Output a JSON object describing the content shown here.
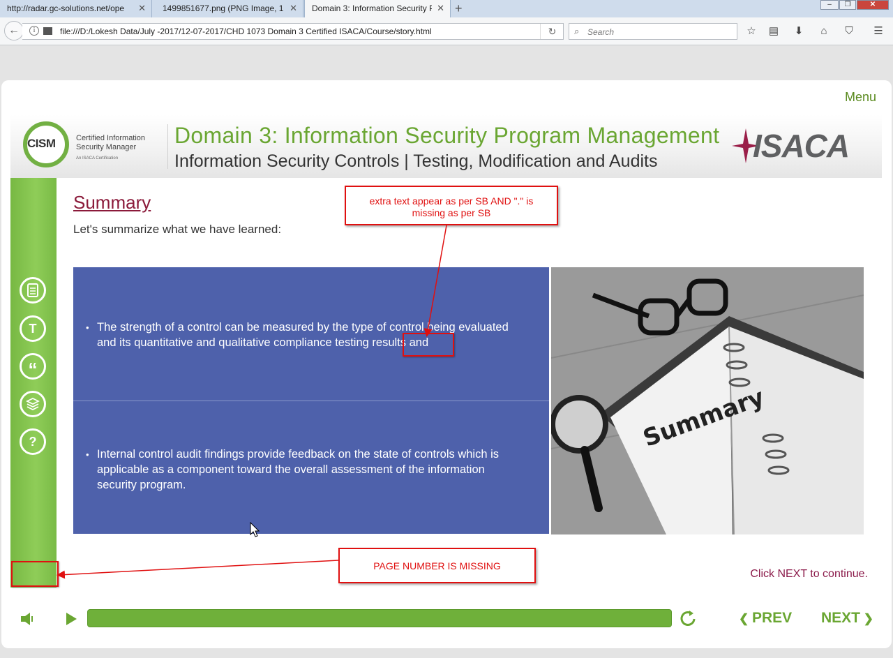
{
  "browser": {
    "tabs": [
      {
        "title": "http://radar.gc-solutions.net/ope",
        "active": false
      },
      {
        "title": "1499851677.png (PNG Image, 127",
        "active": false
      },
      {
        "title": "Domain 3: Information Security P",
        "active": true
      }
    ],
    "url": "file:///D:/Lokesh Data/July -2017/12-07-2017/CHD 1073 Domain 3 Certified ISACA/Course/story.html",
    "search_placeholder": "Search"
  },
  "course": {
    "menu_label": "Menu",
    "cism_logo": {
      "word": "CISM",
      "line1": "Certified Information",
      "line2": "Security Manager",
      "line3": "An ISACA Certification"
    },
    "banner_title": "Domain 3: Information Security Program Management",
    "banner_subtitle": "Information Security Controls | Testing, Modification and Audits",
    "isaca_logo": "ISACA",
    "sidebar_icons": [
      "notes-icon",
      "glossary-icon",
      "quote-icon",
      "layers-icon",
      "help-icon"
    ],
    "sidebar_glyphs": {
      "glossary": "T",
      "quote": "“",
      "help": "?"
    },
    "summary_title": "Summary",
    "summary_intro": "Let's summarize what we have learned:",
    "points": [
      "The strength of a control can be measured by the type of control being evaluated and its quantitative and qualitative compliance testing results and",
      "Internal control audit findings provide feedback on the state of controls which is applicable as a component toward the overall assessment of the information security program."
    ],
    "photo_caption": "Summary",
    "continue_hint": "Click NEXT to continue.",
    "prev_label": "PREV",
    "next_label": "NEXT",
    "progress_fraction": 1.0,
    "bullet": "•"
  },
  "annotations": {
    "extra_text": "extra text appear as per SB AND \".\" is missing as per SB",
    "page_number": "PAGE NUMBER IS MISSING"
  },
  "colors": {
    "accent_green": "#6aa632",
    "panel_blue": "#4e61ab",
    "title_maroon": "#8b1a3a",
    "annotation_red": "#e01010"
  }
}
